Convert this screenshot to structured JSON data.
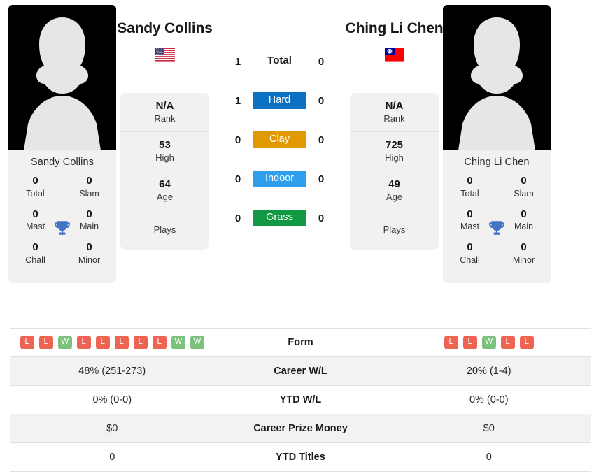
{
  "players": {
    "left": {
      "name": "Sandy Collins",
      "card_name": "Sandy Collins",
      "flag": "us-flag-icon",
      "flag_alt": "United States",
      "rank": "N/A",
      "rank_label": "Rank",
      "high": "53",
      "high_label": "High",
      "age": "64",
      "age_label": "Age",
      "plays": "",
      "plays_label": "Plays",
      "titles": {
        "total": "0",
        "total_label": "Total",
        "slam": "0",
        "slam_label": "Slam",
        "mast": "0",
        "mast_label": "Mast",
        "main": "0",
        "main_label": "Main",
        "chall": "0",
        "chall_label": "Chall",
        "minor": "0",
        "minor_label": "Minor"
      },
      "h2h": {
        "total": "1",
        "hard": "1",
        "clay": "0",
        "indoor": "0",
        "grass": "0"
      },
      "form": [
        "L",
        "L",
        "W",
        "L",
        "L",
        "L",
        "L",
        "L",
        "W",
        "W"
      ],
      "career_wl": "48% (251-273)",
      "ytd_wl": "0% (0-0)",
      "career_prize": "$0",
      "ytd_titles": "0"
    },
    "right": {
      "name": "Ching Li Chen",
      "card_name": "Ching Li Chen",
      "flag": "taiwan-flag-icon",
      "flag_alt": "Chinese Taipei",
      "rank": "N/A",
      "rank_label": "Rank",
      "high": "725",
      "high_label": "High",
      "age": "49",
      "age_label": "Age",
      "plays": "",
      "plays_label": "Plays",
      "titles": {
        "total": "0",
        "total_label": "Total",
        "slam": "0",
        "slam_label": "Slam",
        "mast": "0",
        "mast_label": "Mast",
        "main": "0",
        "main_label": "Main",
        "chall": "0",
        "chall_label": "Chall",
        "minor": "0",
        "minor_label": "Minor"
      },
      "h2h": {
        "total": "0",
        "hard": "0",
        "clay": "0",
        "indoor": "0",
        "grass": "0"
      },
      "form": [
        "L",
        "L",
        "W",
        "L",
        "L"
      ],
      "career_wl": "20% (1-4)",
      "ytd_wl": "0% (0-0)",
      "career_prize": "$0",
      "ytd_titles": "0"
    }
  },
  "surfaces": {
    "total_label": "Total",
    "hard_label": "Hard",
    "clay_label": "Clay",
    "indoor_label": "Indoor",
    "grass_label": "Grass",
    "colors": {
      "hard": "#0c71c3",
      "clay": "#e09900",
      "indoor": "#2f9fed",
      "grass": "#119944"
    }
  },
  "table": {
    "form_label": "Form",
    "career_wl_label": "Career W/L",
    "ytd_wl_label": "YTD W/L",
    "career_prize_label": "Career Prize Money",
    "ytd_titles_label": "YTD Titles"
  },
  "theme": {
    "win_color": "#7cc27c",
    "loss_color": "#ee6352",
    "trophy_color": "#4472c4",
    "card_bg": "#f1f1f1",
    "row_alt_bg": "#f2f2f2"
  }
}
